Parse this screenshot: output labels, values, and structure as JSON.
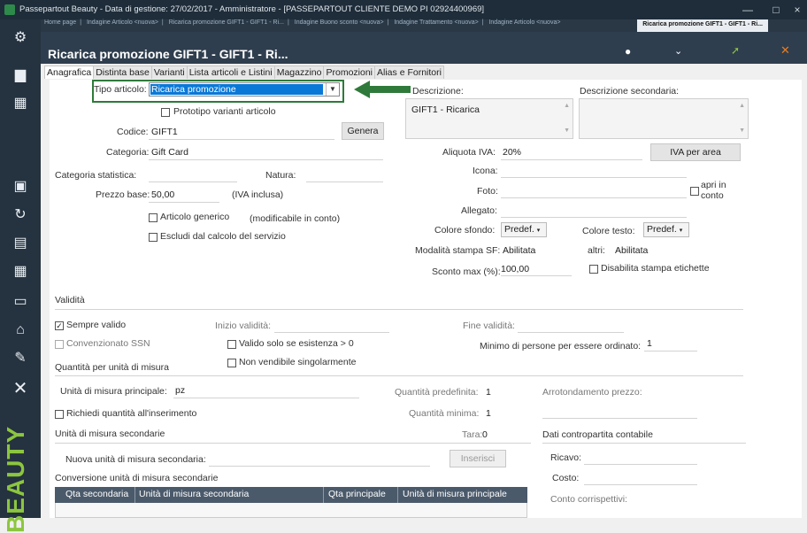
{
  "window": {
    "title": "Passepartout Beauty - Data di gestione: 27/02/2017 - Amministratore - [PASSEPARTOUT CLIENTE DEMO PI 02924400969]",
    "min": "—",
    "max": "□",
    "close": "×"
  },
  "sidebar": {
    "brand": "BEAUTY"
  },
  "doc_tabs": {
    "items": [
      "Home page",
      "Indagine Articolo <nuova>",
      "Ricarica promozione GIFT1 - GIFT1 - Ri...",
      "Indagine Buono sconto <nuova>",
      "Indagine Trattamento <nuova>",
      "Indagine Articolo <nuova>"
    ],
    "active": "Ricarica promozione GIFT1 - GIFT1 - Ri..."
  },
  "page_title": "Ricarica promozione GIFT1 - GIFT1 - Ri...",
  "tabs": [
    "Anagrafica",
    "Distinta base",
    "Varianti",
    "Lista articoli e Listini",
    "Magazzino",
    "Promozioni",
    "Alias e Fornitori"
  ],
  "form": {
    "tipo_label": "Tipo articolo:",
    "tipo_value": "Ricarica promozione",
    "prototipo": "Prototipo varianti articolo",
    "codice_label": "Codice:",
    "codice_value": "GIFT1",
    "genera": "Genera",
    "categoria_label": "Categoria:",
    "categoria_value": "Gift Card",
    "cat_stat_label": "Categoria statistica:",
    "natura_label": "Natura:",
    "prezzo_label": "Prezzo base:",
    "prezzo_value": "50,00",
    "iva_inclusa": "(IVA inclusa)",
    "art_generico": "Articolo generico",
    "modificabile": "(modificabile in conto)",
    "escludi": "Escludi dal calcolo del servizio",
    "descr_label": "Descrizione:",
    "descr_value": "GIFT1 - Ricarica",
    "descr_sec_label": "Descrizione secondaria:",
    "aliquota_label": "Aliquota IVA:",
    "aliquota_value": "20%",
    "iva_area": "IVA per area",
    "icona": "Icona:",
    "foto": "Foto:",
    "apri_in": "apri in",
    "conto": "conto",
    "allegato": "Allegato:",
    "colore_sfondo_label": "Colore sfondo:",
    "colore_sfondo_value": "Predef.",
    "colore_testo_label": "Colore testo:",
    "colore_testo_value": "Predef.",
    "mod_stampa_label": "Modalità stampa SF:",
    "mod_stampa_value": "Abilitata",
    "altri_label": "altri:",
    "altri_value": "Abilitata",
    "sconto_label": "Sconto max (%):",
    "sconto_value": "100,00",
    "disabilita": "Disabilita stampa etichette",
    "validita": "Validità",
    "sempre_valido": "Sempre valido",
    "inizio": "Inizio validità:",
    "fine": "Fine validità:",
    "convenzionato": "Convenzionato SSN",
    "valido_solo": "Valido solo se esistenza > 0",
    "minimo_label": "Minimo di persone per essere ordinato:",
    "minimo_value": "1",
    "non_vendibile": "Non vendibile singolarmente",
    "qta_per_unita": "Quantità per unità di misura",
    "um_principale_label": "Unità di misura principale:",
    "um_principale_value": "pz",
    "qta_predef_label": "Quantità predefinita:",
    "qta_predef_value": "1",
    "arrotondamento": "Arrotondamento prezzo:",
    "richiedi": "Richiedi quantità all'inserimento",
    "qta_min_label": "Quantità minima:",
    "qta_min_value": "1",
    "um_secondarie": "Unità di misura secondarie",
    "tara_label": "Tara:",
    "tara_value": "0",
    "dati_contropartita": "Dati contropartita contabile",
    "nuova_um": "Nuova unità di misura secondaria:",
    "inserisci": "Inserisci",
    "ricavo": "Ricavo:",
    "conversione": "Conversione unità di misura secondarie",
    "costo": "Costo:",
    "conto_corrisp": "Conto corrispettivi:"
  },
  "grid": {
    "columns": [
      "Qta secondaria",
      "Unità di misura secondaria",
      "Qta principale",
      "Unità di misura principale"
    ]
  }
}
